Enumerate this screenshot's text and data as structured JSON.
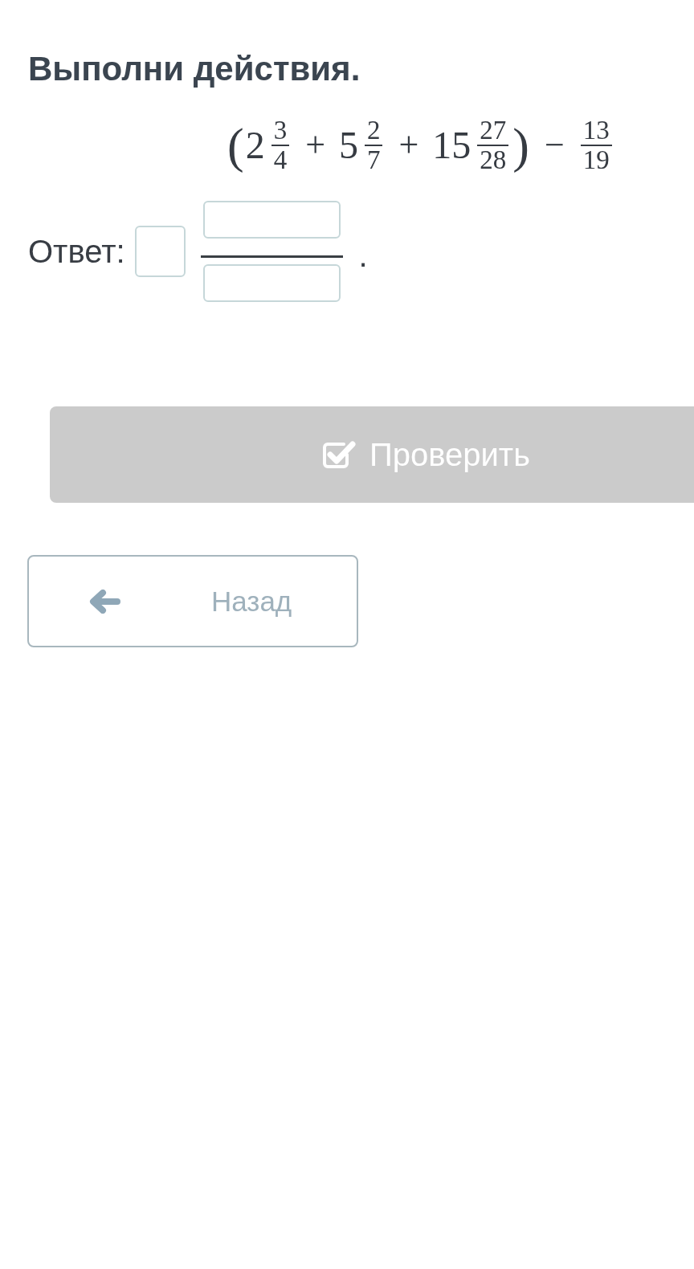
{
  "task": {
    "title": "Выполни действия.",
    "expression": [
      {
        "kind": "paren",
        "text": "("
      },
      {
        "kind": "mixed",
        "whole": "2",
        "numerator": "3",
        "denominator": "4"
      },
      {
        "kind": "operator",
        "text": "+"
      },
      {
        "kind": "mixed",
        "whole": "5",
        "numerator": "2",
        "denominator": "7"
      },
      {
        "kind": "operator",
        "text": "+"
      },
      {
        "kind": "mixed",
        "whole": "15",
        "numerator": "27",
        "denominator": "28"
      },
      {
        "kind": "paren",
        "text": ")"
      },
      {
        "kind": "operator",
        "text": "−"
      },
      {
        "kind": "fraction",
        "numerator": "13",
        "denominator": "19"
      }
    ]
  },
  "answer": {
    "label": "Ответ:",
    "kind": "mixed_fraction",
    "end_mark": "."
  },
  "buttons": [
    {
      "kind": "check",
      "label": "Проверить",
      "disabled": true
    },
    {
      "kind": "back",
      "label": "Назад"
    }
  ]
}
